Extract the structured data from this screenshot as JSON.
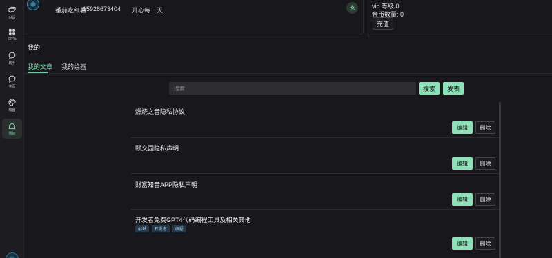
{
  "sidebar": {
    "items": [
      {
        "label": "对话",
        "icon": "chat-icon"
      },
      {
        "label": "GPTs",
        "icon": "grid-icon"
      },
      {
        "label": "助手",
        "icon": "assistant-icon"
      },
      {
        "label": "主页",
        "icon": "home-chat-icon"
      },
      {
        "label": "绘画",
        "icon": "palette-icon"
      },
      {
        "label": "我的",
        "icon": "house-icon",
        "active": true
      }
    ]
  },
  "profile": {
    "username": "番茄吃红薯",
    "phone": "15928673404",
    "motto": "开心每一天"
  },
  "account": {
    "vip_level": "vip 等级 0",
    "coin_count": "金币数量: 0",
    "recharge_label": "充值"
  },
  "page": {
    "title": "我的",
    "tabs": [
      {
        "label": "我的文章",
        "active": true
      },
      {
        "label": "我的绘画",
        "active": false
      }
    ]
  },
  "search": {
    "placeholder": "搜索",
    "search_label": "搜索",
    "publish_label": "发表"
  },
  "articles": [
    {
      "title": "燃烧之音隐私协议",
      "tags": []
    },
    {
      "title": "颐交园隐私声明",
      "tags": []
    },
    {
      "title": "财富知音APP隐私声明",
      "tags": []
    },
    {
      "title": "开发者免费GPT4代码编程工具及相关其他",
      "tags": [
        "gpt4",
        "开发者",
        "编程"
      ]
    }
  ],
  "article_actions": {
    "edit_label": "编辑",
    "delete_label": "删除"
  },
  "colors": {
    "accent": "#8ee0b8",
    "background": "#18181c",
    "tag_bg": "#24384a"
  }
}
